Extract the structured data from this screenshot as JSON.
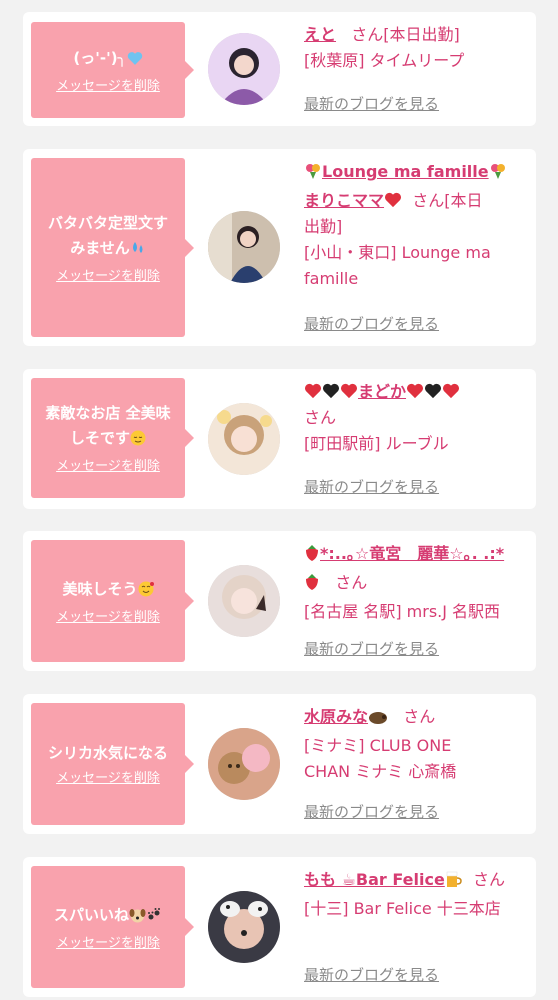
{
  "delete_label": "メッセージを削除",
  "blog_label": "最新のブログを見る",
  "san": "さん",
  "cards": [
    {
      "message": "(っ'-')╮",
      "name": "えと",
      "tag": "[本日出勤]",
      "shop": "[秋葉原] タイムリープ"
    },
    {
      "message_l1": "バタバタ定型文す",
      "message_l2": "みません",
      "name_l1": "Lounge ma famille",
      "name_l2": "まりこママ",
      "tag_a": "[本日",
      "tag_b": "出勤]",
      "shop_l1": "[小山・東口] Lounge ma",
      "shop_l2": "famille"
    },
    {
      "message_l1": "素敵なお店 全美味",
      "message_l2": "しそです",
      "name": "まどか",
      "shop": "[町田駅前] ルーブル"
    },
    {
      "message": "美味しそう",
      "name_l1": "*:..｡☆竜宮　麗華☆｡. .:*",
      "shop": "[名古屋 名駅] mrs.J 名駅西"
    },
    {
      "message": "シリカ水気になる",
      "name": "水原みな",
      "shop_l1": "[ミナミ] CLUB ONE",
      "shop_l2": "CHAN ミナミ 心斎橋"
    },
    {
      "message": "スパいいね",
      "name": "もも ☕Bar Felice",
      "shop": "[十三] Bar Felice 十三本店"
    }
  ],
  "colors": {
    "bubble": "#f9a2ad",
    "name": "#d63c72",
    "blog_link": "#8a8a8a",
    "background": "#f2f2f2"
  },
  "icons": [
    "blue-heart-icon",
    "bouquet-icon",
    "red-heart-icon",
    "black-heart-icon",
    "sweat-drops-icon",
    "relieved-face-icon",
    "smiling-hearts-face-icon",
    "strawberry-icon",
    "boar-icon",
    "dog-face-icon",
    "paw-prints-icon",
    "coffee-icon",
    "beer-mug-icon"
  ]
}
